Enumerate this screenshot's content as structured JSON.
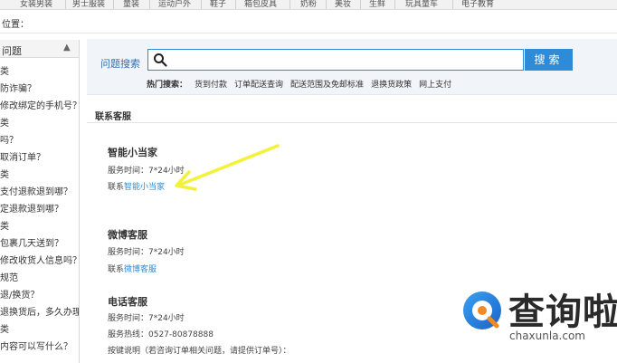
{
  "top_nav": {
    "items": [
      "女装男装",
      "男士服装",
      "童装",
      "运动户外",
      "鞋子",
      "箱包皮具",
      "奶粉",
      "美妆",
      "生鲜",
      "玩具童车",
      "电子教育"
    ]
  },
  "location_label": "位置：",
  "sidebar": {
    "header": "问题",
    "items": [
      "类",
      "防诈骗？",
      "修改绑定的手机号？",
      "类",
      "吗？",
      "取消订单？",
      "类",
      "支付退款退到哪？",
      "定退款退到哪？",
      "类",
      "包裹几天送到？",
      "修改收货人信息吗？",
      "规范",
      "退/换货？",
      "退换货后，多久办理？",
      "类",
      "内容可以写什么？"
    ]
  },
  "search": {
    "label": "问题搜索",
    "placeholder": "",
    "button": "搜索",
    "hot_label": "热门搜索：",
    "hot_links": [
      "货到付款",
      "订单配送查询",
      "配送范围及免邮标准",
      "退换货政策",
      "网上支付"
    ]
  },
  "contact": {
    "section_title": "联系客服",
    "blocks": [
      {
        "title": "智能小当家",
        "service_time": "服务时间：7*24小时",
        "link_prefix": "联系",
        "link": "智能小当家"
      },
      {
        "title": "微博客服",
        "service_time": "服务时间：7*24小时",
        "link_prefix": "联系",
        "link": "微博客服"
      },
      {
        "title": "电话客服",
        "service_time": "服务时间：7*24小时",
        "hotline": "服务热线：0527-80878888",
        "note": "按键说明（若咨询订单相关问题，请提供订单号）："
      }
    ]
  },
  "watermark": {
    "text": "查询啦",
    "domain": "chaxunla.com"
  },
  "colors": {
    "accent": "#2e8bd8",
    "arrow": "#f2f23a"
  }
}
